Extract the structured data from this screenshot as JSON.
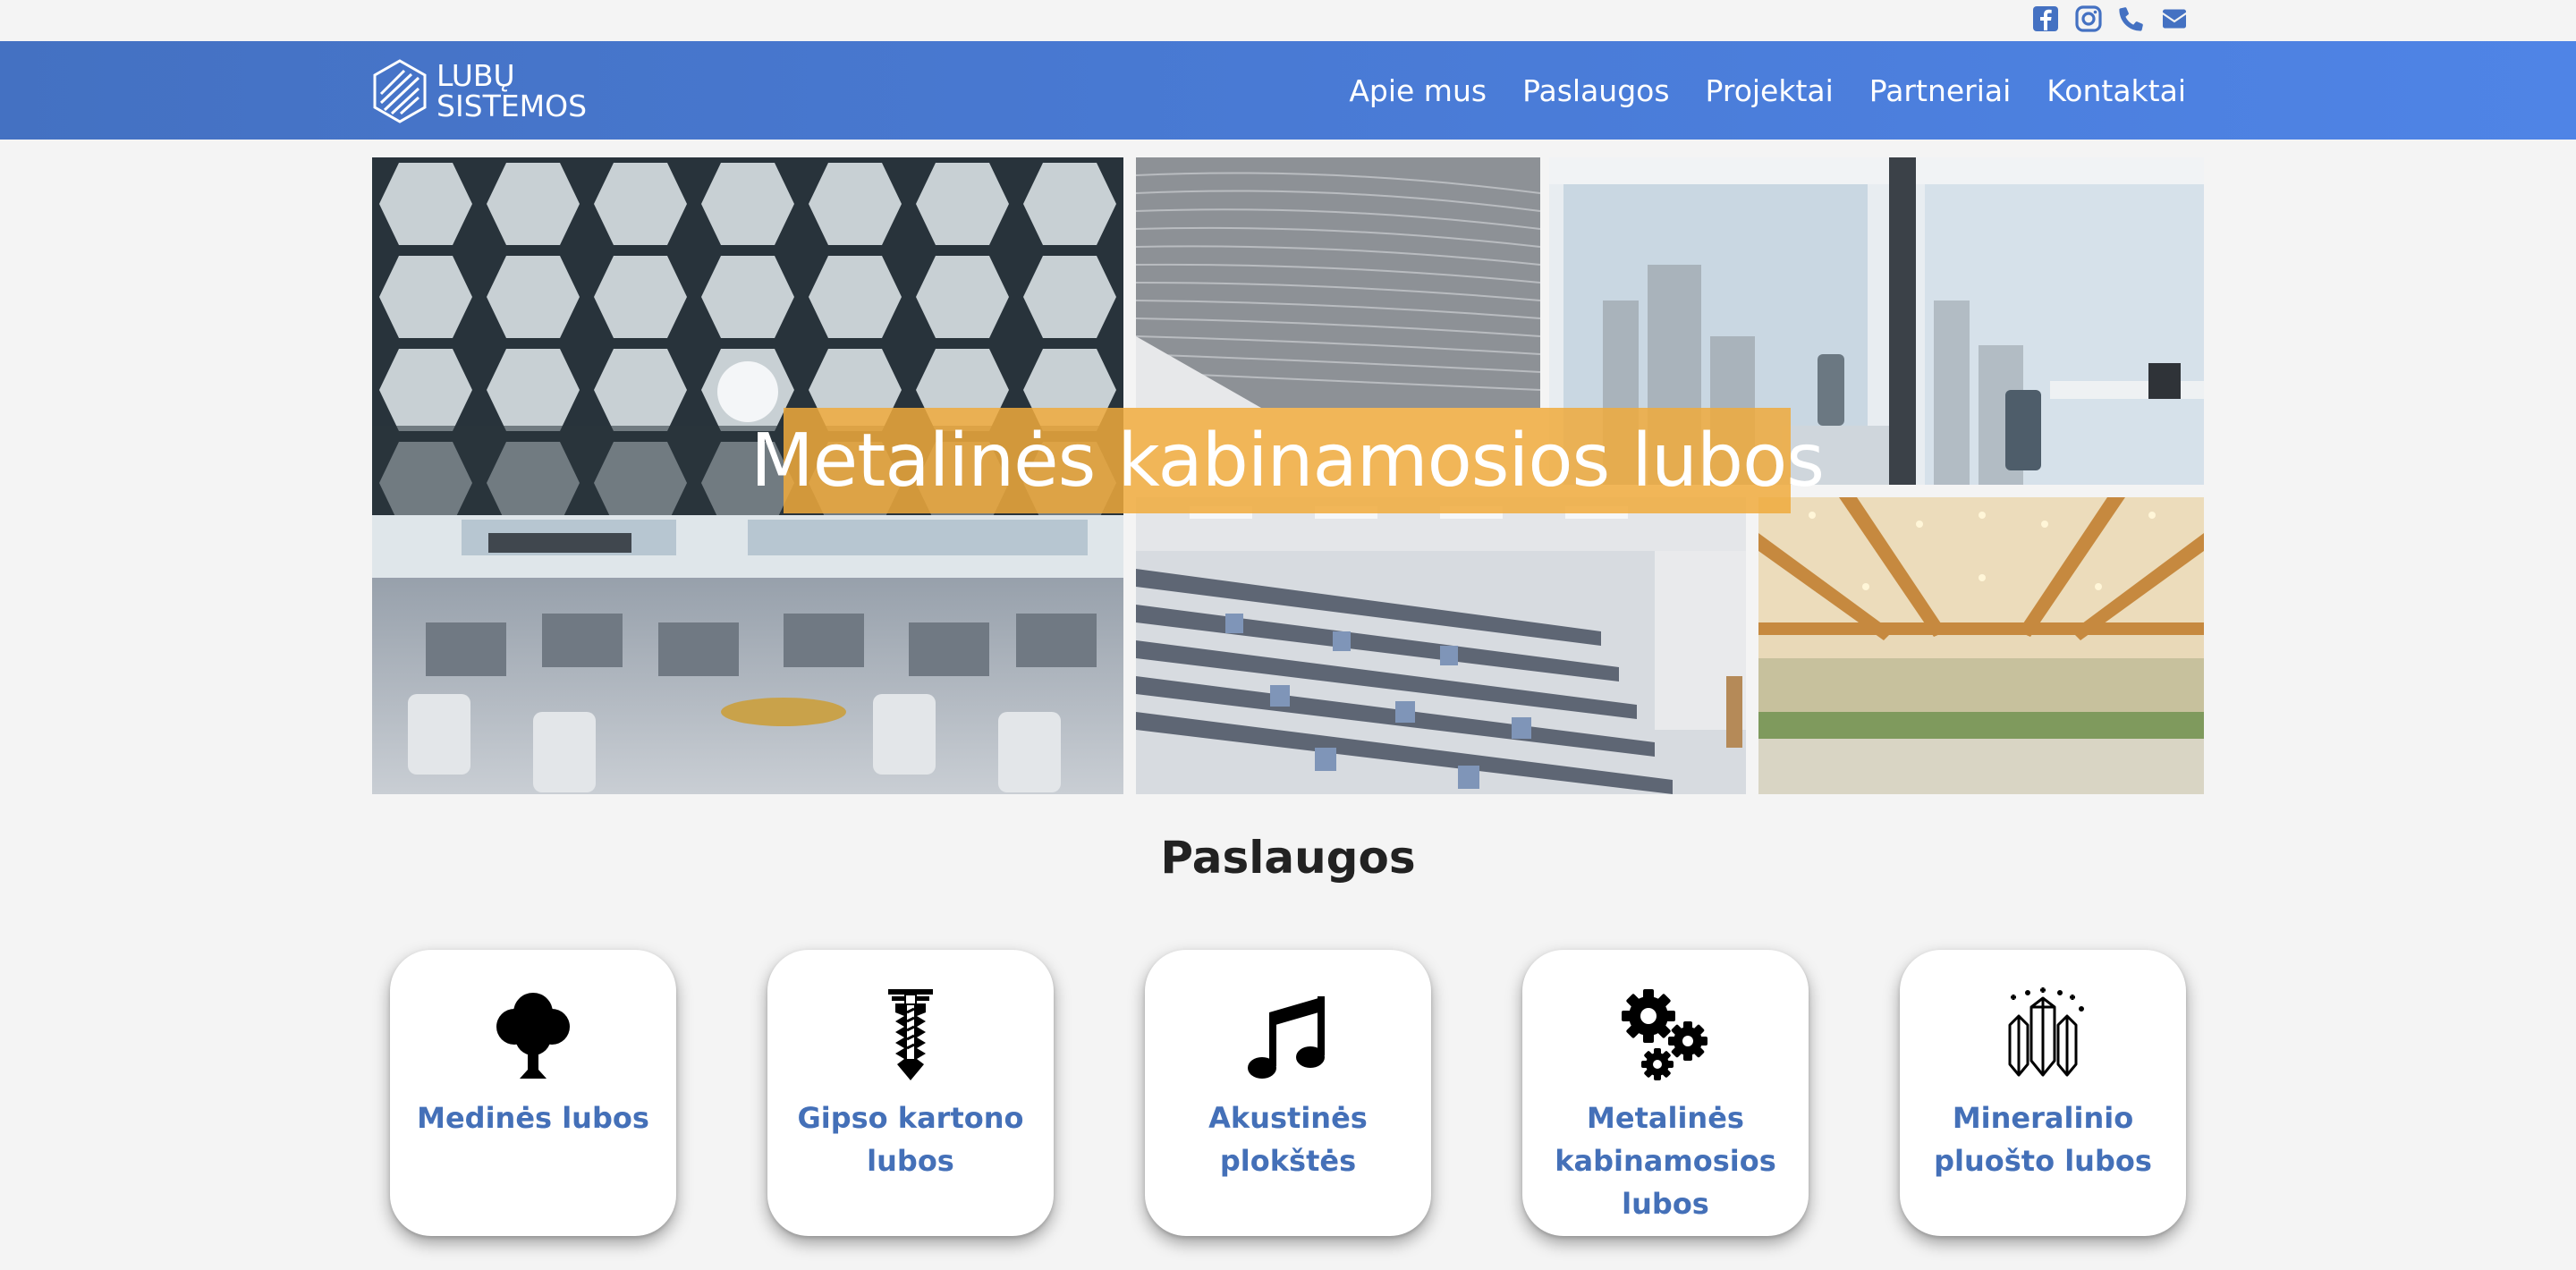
{
  "social": {
    "icons": [
      "facebook-icon",
      "instagram-icon",
      "phone-icon",
      "email-icon"
    ],
    "color": "#4471c2"
  },
  "header": {
    "logo_line1": "LUBŲ",
    "logo_line2": "SISTEMOS",
    "nav": [
      "Apie mus",
      "Paslaugos",
      "Projektai",
      "Partneriai",
      "Kontaktai"
    ]
  },
  "hero": {
    "title": "Metalinės kabinamosios lubos",
    "banner_color": "#f0aa3c"
  },
  "services": {
    "title": "Paslaugos",
    "items": [
      {
        "label": "Medinės lubos",
        "icon": "tree-icon"
      },
      {
        "label": "Gipso kartono lubos",
        "icon": "screw-anchor-icon"
      },
      {
        "label": "Akustinės plokštės",
        "icon": "music-note-icon"
      },
      {
        "label": "Metalinės kabinamosios lubos",
        "icon": "gears-icon"
      },
      {
        "label": "Mineralinio pluošto lubos",
        "icon": "crystals-icon"
      }
    ],
    "label_color": "#4470b8"
  }
}
